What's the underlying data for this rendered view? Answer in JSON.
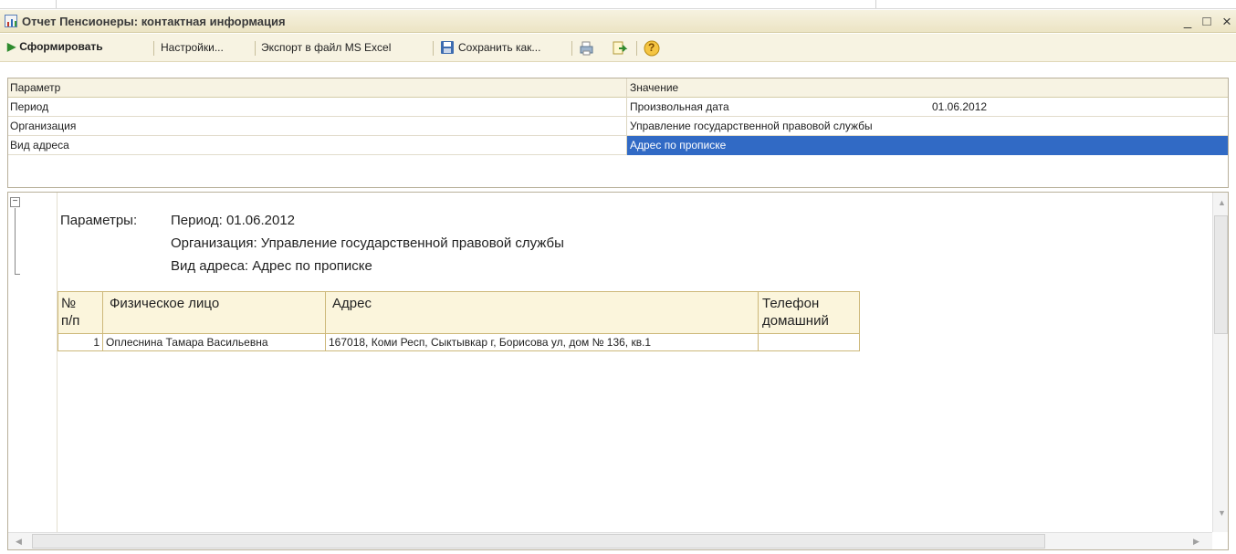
{
  "window": {
    "title": "Отчет  Пенсионеры: контактная информация",
    "controls": {
      "minimize": "_",
      "maximize": "□",
      "close": "×"
    }
  },
  "toolbar": {
    "run_label": "Сформировать",
    "settings_label": "Настройки...",
    "export_label": "Экспорт в файл MS Excel",
    "save_as_label": "Сохранить как...",
    "help_label": "?"
  },
  "params_table": {
    "headers": {
      "param": "Параметр",
      "value": "Значение"
    },
    "rows": [
      {
        "param": "Период",
        "value": "Произвольная дата",
        "extra": "01.06.2012"
      },
      {
        "param": "Организация",
        "value": "Управление государственной правовой службы",
        "extra": ""
      },
      {
        "param": "Вид адреса",
        "value": "Адрес по прописке",
        "extra": ""
      }
    ]
  },
  "report": {
    "params_label": "Параметры:",
    "params_lines": [
      "Период: 01.06.2012",
      "Организация: Управление государственной правовой службы",
      "Вид адреса: Адрес по прописке"
    ],
    "table": {
      "headers": {
        "num": "№\nп/п",
        "person": "Физическое лицо",
        "address": "Адрес",
        "phone": "Телефон\nдомашний"
      },
      "rows": [
        {
          "num": "1",
          "person": "Оплеснина Тамара Васильевна",
          "address": "167018, Коми Респ, Сыктывкар г, Борисова ул, дом № 136, кв.1",
          "phone": ""
        }
      ]
    }
  },
  "colors": {
    "title_bg": "#ece4c4",
    "toolbar_bg": "#f7f3e2",
    "selection": "#316ac5",
    "table_border": "#cdb87a",
    "header_bg": "#fbf5dc"
  },
  "icons": {
    "run": "play-icon",
    "save": "floppy-disk-icon",
    "print": "printer-icon",
    "export": "export-icon",
    "help": "help-icon",
    "app": "report-icon"
  }
}
